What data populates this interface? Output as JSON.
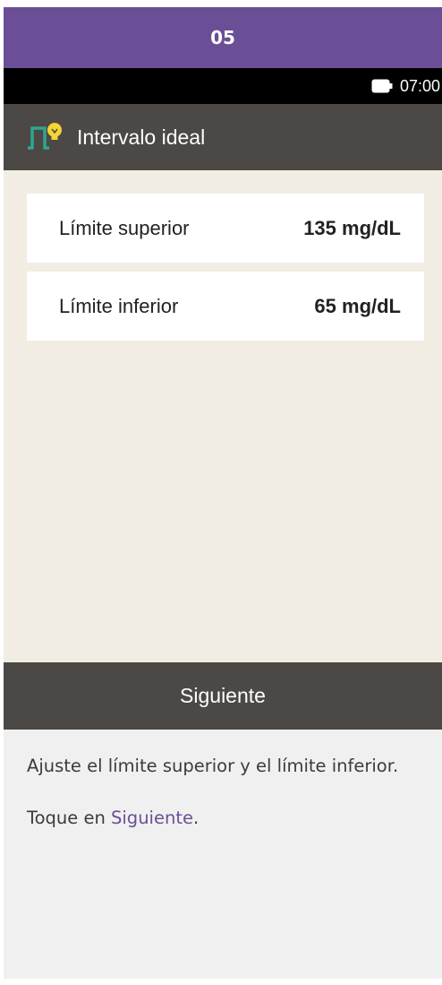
{
  "step": {
    "number": "05"
  },
  "status_bar": {
    "time": "07:00",
    "icon": "battery-icon"
  },
  "header": {
    "title": "Intervalo ideal",
    "icon": "target-range-icon"
  },
  "settings": {
    "upper": {
      "label": "Límite superior",
      "value": "135 mg/dL"
    },
    "lower": {
      "label": "Límite inferior",
      "value": "65 mg/dL"
    }
  },
  "footer": {
    "next_label": "Siguiente"
  },
  "instructions": {
    "line1": "Ajuste el límite superior y el límite inferior.",
    "line2_prefix": "Toque en ",
    "line2_link": "Siguiente",
    "line2_suffix": "."
  },
  "colors": {
    "accent": "#6a4f96",
    "bar": "#4b4845",
    "screen_bg": "#f1ede3",
    "icon_green": "#2fa58d",
    "icon_yellow": "#f5d433"
  }
}
